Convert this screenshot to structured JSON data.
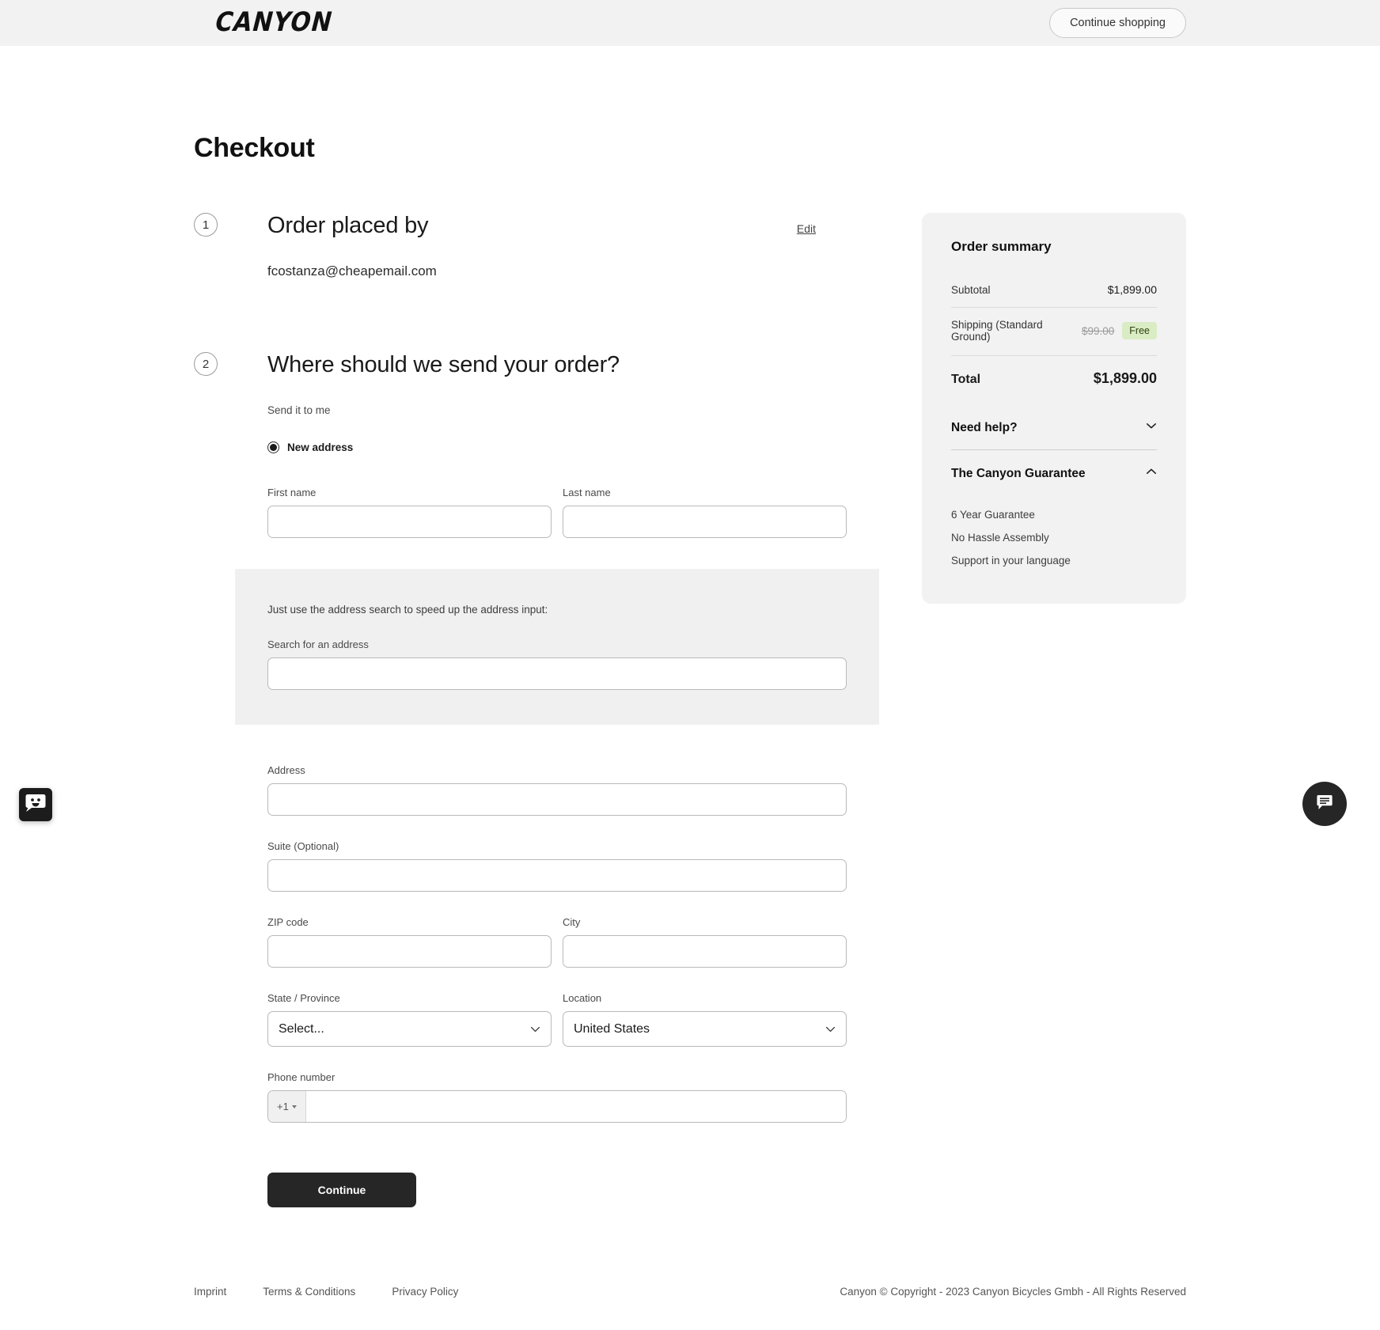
{
  "header": {
    "logo_text": "CANYON",
    "continue_shopping_label": "Continue shopping"
  },
  "page_title": "Checkout",
  "steps": [
    {
      "number": "1",
      "title": "Order placed by",
      "edit_label": "Edit",
      "email": "fcostanza@cheapemail.com"
    },
    {
      "number": "2",
      "title": "Where should we send your order?",
      "delivery_label": "Send it to me",
      "radio_label": "New address"
    }
  ],
  "form": {
    "first_name": {
      "label": "First name",
      "value": "",
      "placeholder": ""
    },
    "last_name": {
      "label": "Last name",
      "value": "",
      "placeholder": ""
    },
    "search_panel": {
      "hint": "Just use the address search to speed up the address input:",
      "search_label": "Search for an address",
      "search_value": "",
      "search_placeholder": ""
    },
    "address": {
      "label": "Address",
      "value": "",
      "placeholder": ""
    },
    "suite": {
      "label": "Suite (Optional)",
      "value": "",
      "placeholder": ""
    },
    "zip": {
      "label": "ZIP code",
      "value": "",
      "placeholder": ""
    },
    "city": {
      "label": "City",
      "value": "",
      "placeholder": ""
    },
    "state": {
      "label": "State / Province",
      "selected": "Select..."
    },
    "location": {
      "label": "Location",
      "selected": "United States"
    },
    "phone": {
      "label": "Phone number",
      "country_code": "+1",
      "value": "",
      "placeholder": ""
    },
    "continue_label": "Continue"
  },
  "summary": {
    "title": "Order summary",
    "rows": [
      {
        "label": "Subtotal",
        "value": "$1,899.00"
      },
      {
        "label": "Shipping (Standard Ground)",
        "old_value": "$99.00",
        "badge": "Free"
      }
    ],
    "total_label": "Total",
    "total_value": "$1,899.00",
    "accordions": [
      {
        "title": "Need help?",
        "expanded": false
      },
      {
        "title": "The Canyon Guarantee",
        "expanded": true
      }
    ],
    "guarantee_items": [
      "6 Year Guarantee",
      "No Hassle Assembly",
      "Support in your language"
    ]
  },
  "footer": {
    "links": [
      "Imprint",
      "Terms & Conditions",
      "Privacy Policy"
    ],
    "copyright": "Canyon © Copyright - 2023 Canyon Bicycles Gmbh - All Rights Reserved"
  },
  "colors": {
    "accent_dark": "#262626",
    "panel_gray": "#f2f2f2",
    "badge_green_bg": "#d9ecc3"
  }
}
